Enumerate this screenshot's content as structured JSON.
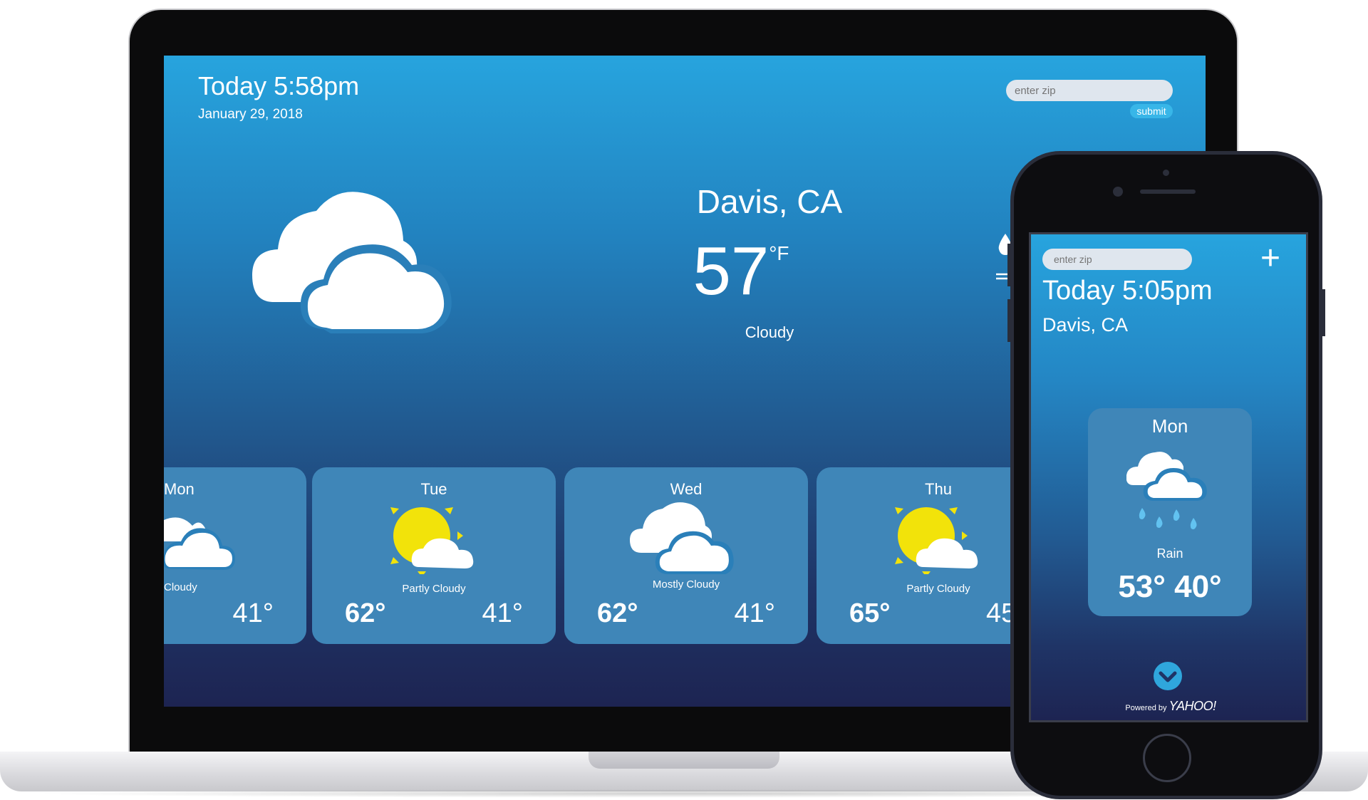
{
  "desktop": {
    "time": "Today 5:58pm",
    "date": "January 29, 2018",
    "zip_placeholder": "enter zip",
    "submit_label": "submit",
    "city": "Davis, CA",
    "temp": "57",
    "unit": "°F",
    "condition": "Cloudy",
    "forecast": [
      {
        "day": "Mon",
        "label": "Cloudy",
        "hi": "",
        "lo": "41°",
        "icon": "cloudy-icon"
      },
      {
        "day": "Tue",
        "label": "Partly Cloudy",
        "hi": "62°",
        "lo": "41°",
        "icon": "partly-cloudy-icon"
      },
      {
        "day": "Wed",
        "label": "Mostly Cloudy",
        "hi": "62°",
        "lo": "41°",
        "icon": "mostly-cloudy-icon"
      },
      {
        "day": "Thu",
        "label": "Partly Cloudy",
        "hi": "65°",
        "lo": "45",
        "icon": "partly-cloudy-icon"
      }
    ],
    "side_icons": [
      "raindrop-icon",
      "wind-icon"
    ]
  },
  "phone": {
    "zip_placeholder": "enter zip",
    "add_label": "+",
    "time": "Today 5:05pm",
    "city": "Davis, CA",
    "card": {
      "day": "Mon",
      "label": "Rain",
      "temps": "53°  40°",
      "icon": "rain-icon"
    },
    "powered_by": "Powered by",
    "provider": "YAHOO!"
  },
  "colors": {
    "sky_top": "#27a4de",
    "sky_bottom": "#1d2452",
    "card": "#3f86b8",
    "sun": "#f2e30a",
    "submit": "#38b6e8"
  }
}
